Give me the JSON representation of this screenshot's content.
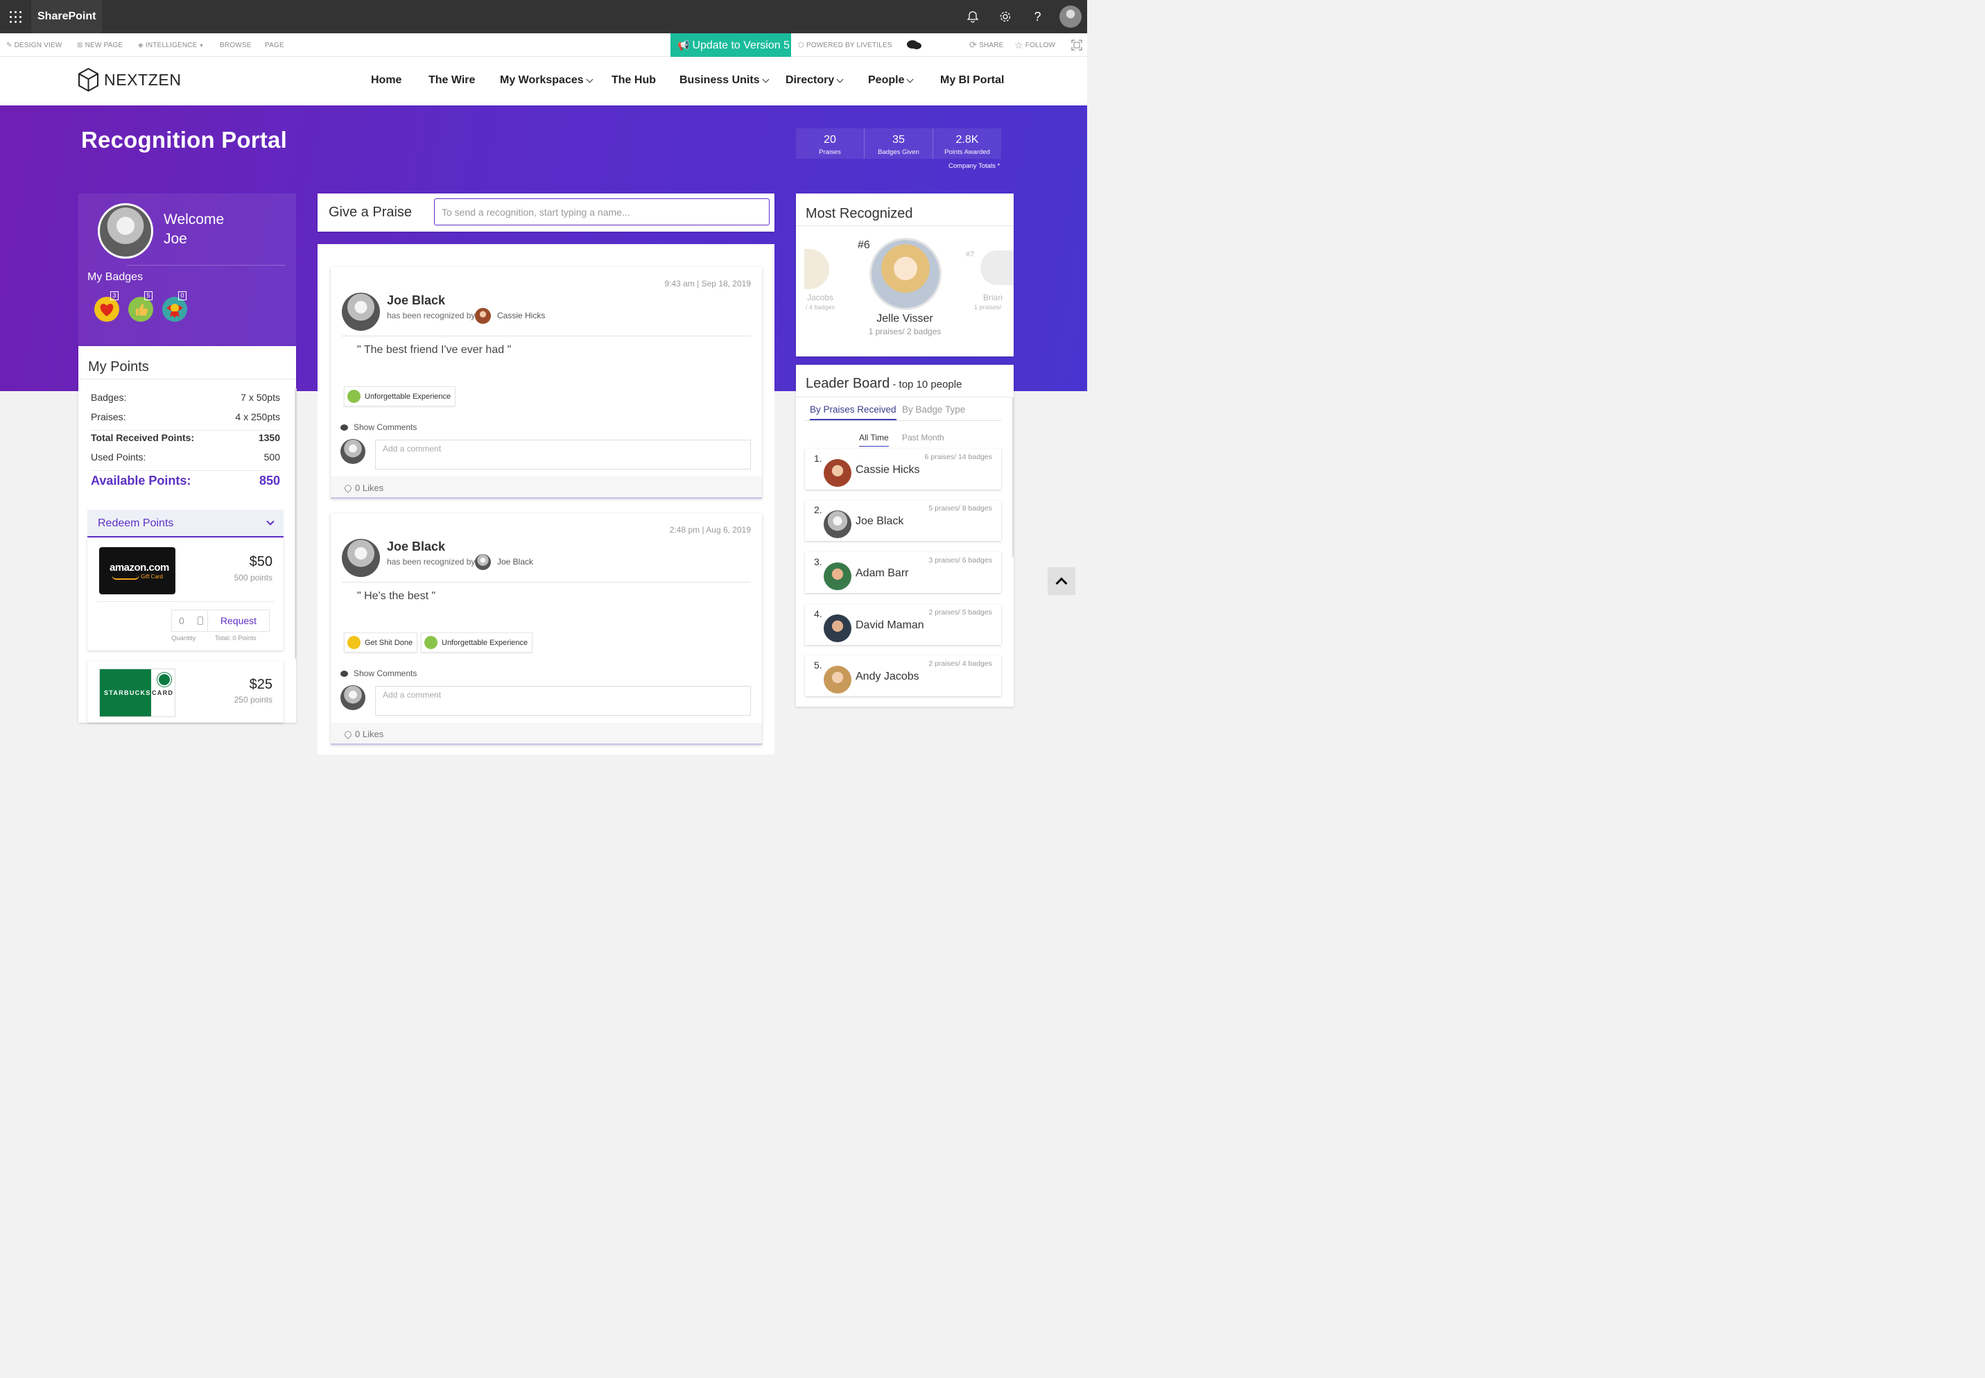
{
  "suite": {
    "brand": "SharePoint"
  },
  "commandbar": {
    "design_view": "DESIGN VIEW",
    "new_page": "NEW PAGE",
    "intelligence": "INTELLIGENCE",
    "browse": "BROWSE",
    "page": "PAGE",
    "update": "Update to Version 5",
    "powered": "POWERED BY LIVETILES",
    "share": "SHARE",
    "follow": "FOLLOW"
  },
  "nav": {
    "logo": "NEXTZEN",
    "items": [
      "Home",
      "The Wire",
      "My Workspaces",
      "The Hub",
      "Business Units",
      "Directory",
      "People",
      "My BI Portal"
    ]
  },
  "hero": {
    "title": "Recognition Portal",
    "totals": [
      {
        "value": "20",
        "label": "Praises"
      },
      {
        "value": "35",
        "label": "Badges Given"
      },
      {
        "value": "2.8K",
        "label": "Points Awarded"
      }
    ],
    "note": "Company Totals *"
  },
  "welcome": {
    "line1": "Welcome",
    "line2": "Joe",
    "badges_title": "My Badges",
    "badges": [
      {
        "icon": "heart-badge-icon",
        "count": "3",
        "color": "#f2c318"
      },
      {
        "icon": "thumbs-up-badge-icon",
        "count": "5",
        "color": "#8bc34a"
      },
      {
        "icon": "award-ribbon-badge-icon",
        "count": "0",
        "color": "#3aa6a6"
      }
    ]
  },
  "points": {
    "title": "My Points",
    "rows": [
      {
        "label": "Badges:",
        "value": "7 x 50pts"
      },
      {
        "label": "Praises:",
        "value": "4 x 250pts"
      },
      {
        "label": "Total Received Points:",
        "value": "1350"
      },
      {
        "label": "Used Points:",
        "value": "500"
      }
    ],
    "available_label": "Available Points:",
    "available_value": "850",
    "redeem_label": "Redeem Points",
    "gifts": [
      {
        "brand": "amazon.com",
        "sub": "Gift Card",
        "price": "$50",
        "points": "500 points",
        "qty": "0",
        "request": "Request",
        "qty_label": "Quantity",
        "total_label": "Total: 0 Points"
      },
      {
        "brand": "STARBUCKS",
        "sub": "CARD",
        "price": "$25",
        "points": "250 points"
      }
    ]
  },
  "praise": {
    "title": "Give a Praise",
    "placeholder": "To send a recognition, start typing a name..."
  },
  "posts": [
    {
      "time": "9:43 am | Sep 18, 2019",
      "name": "Joe Black",
      "by": "has been recognized by",
      "recognizer": "Cassie Hicks",
      "quote": "\" The best friend I've ever had \"",
      "badges": [
        {
          "label": "Unforgettable Experience",
          "icon": "thumbs-up-badge-icon"
        }
      ],
      "show_comments": "Show Comments",
      "comment_placeholder": "Add a comment",
      "likes": "0 Likes"
    },
    {
      "time": "2:48 pm | Aug 6, 2019",
      "name": "Joe Black",
      "by": "has been recognized by",
      "recognizer": "Joe Black",
      "quote": "\" He's the best \"",
      "badges": [
        {
          "label": "Get Shit Done",
          "icon": "heart-badge-icon"
        },
        {
          "label": "Unforgettable Experience",
          "icon": "thumbs-up-badge-icon"
        }
      ],
      "show_comments": "Show Comments",
      "comment_placeholder": "Add a comment",
      "likes": "0 Likes"
    }
  ],
  "most_recognized": {
    "title": "Most Recognized",
    "left_name": "Jacobs",
    "left_sub": "/ 4 badges",
    "rank": "#6",
    "name": "Jelle Visser",
    "sub": "1 praises/ 2 badges",
    "right_rank": "#7",
    "right_name": "Brian",
    "right_sub": "1 praises/"
  },
  "leaderboard": {
    "title": "Leader Board",
    "title_suffix": " - top 10 people",
    "tabs": [
      "By Praises Received",
      "By Badge Type"
    ],
    "subtabs": [
      "All Time",
      "Past Month"
    ],
    "entries": [
      {
        "rank": "1.",
        "name": "Cassie Hicks",
        "stat": "6 praises/ 14 badges"
      },
      {
        "rank": "2.",
        "name": "Joe Black",
        "stat": "5 praises/ 8 badges"
      },
      {
        "rank": "3.",
        "name": "Adam Barr",
        "stat": "3 praises/ 6 badges"
      },
      {
        "rank": "4.",
        "name": "David Maman",
        "stat": "2 praises/ 5 badges"
      },
      {
        "rank": "5.",
        "name": "Andy Jacobs",
        "stat": "2 praises/ 4 badges"
      }
    ]
  },
  "colors": {
    "accent": "#5c30c6",
    "update": "#1bbc9b",
    "hero_start": "#6f1fb3",
    "hero_end": "#4a34cf"
  }
}
